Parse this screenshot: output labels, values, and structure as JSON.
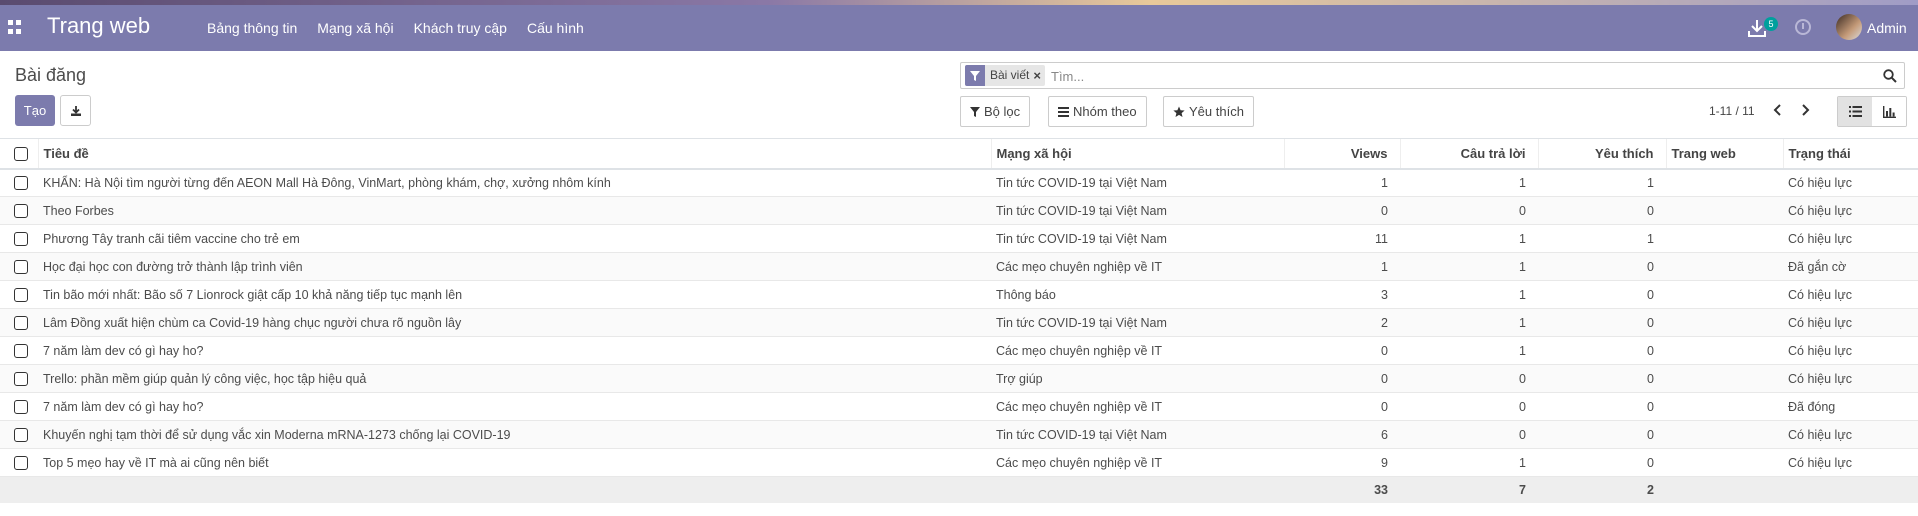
{
  "navbar": {
    "brand": "Trang web",
    "menu": [
      "Bảng thông tin",
      "Mạng xã hội",
      "Khách truy cập",
      "Cấu hình"
    ],
    "download_badge": "5",
    "user": "Admin"
  },
  "control": {
    "title": "Bài đăng",
    "create_label": "Tạo",
    "facet_label": "Bài viết",
    "facet_remove": "×",
    "search_placeholder": "Tìm...",
    "filters_label": "Bộ lọc",
    "group_label": "Nhóm theo",
    "favorites_label": "Yêu thích",
    "pager": "1-11 / 11"
  },
  "table": {
    "headers": {
      "title": "Tiêu đề",
      "network": "Mạng xã hội",
      "views": "Views",
      "replies": "Câu trả lời",
      "likes": "Yêu thích",
      "website": "Trang web",
      "status": "Trạng thái"
    },
    "rows": [
      {
        "title": "KHẨN: Hà Nội tìm người từng đến AEON Mall Hà Đông, VinMart, phòng khám, chợ, xưởng nhôm kính",
        "network": "Tin tức COVID-19 tại Việt Nam",
        "views": "1",
        "replies": "1",
        "likes": "1",
        "website": "",
        "status": "Có hiệu lực"
      },
      {
        "title": "Theo Forbes",
        "network": "Tin tức COVID-19 tại Việt Nam",
        "views": "0",
        "replies": "0",
        "likes": "0",
        "website": "",
        "status": "Có hiệu lực"
      },
      {
        "title": "Phương Tây tranh cãi tiêm vaccine cho trẻ em",
        "network": "Tin tức COVID-19 tại Việt Nam",
        "views": "11",
        "replies": "1",
        "likes": "1",
        "website": "",
        "status": "Có hiệu lực"
      },
      {
        "title": "Học đại học con đường trở thành lập trình viên",
        "network": "Các mẹo chuyên nghiệp về IT",
        "views": "1",
        "replies": "1",
        "likes": "0",
        "website": "",
        "status": "Đã gắn cờ"
      },
      {
        "title": "Tin bão mới nhất: Bão số 7 Lionrock giật cấp 10 khả năng tiếp tục mạnh lên",
        "network": "Thông báo",
        "views": "3",
        "replies": "1",
        "likes": "0",
        "website": "",
        "status": "Có hiệu lực"
      },
      {
        "title": "Lâm Đồng xuất hiện chùm ca Covid-19 hàng chục người chưa rõ nguồn lây",
        "network": "Tin tức COVID-19 tại Việt Nam",
        "views": "2",
        "replies": "1",
        "likes": "0",
        "website": "",
        "status": "Có hiệu lực"
      },
      {
        "title": "7 năm làm dev có gì hay ho?",
        "network": "Các mẹo chuyên nghiệp về IT",
        "views": "0",
        "replies": "1",
        "likes": "0",
        "website": "",
        "status": "Có hiệu lực"
      },
      {
        "title": "Trello: phần mềm giúp quản lý công việc, học tập hiệu quả",
        "network": "Trợ giúp",
        "views": "0",
        "replies": "0",
        "likes": "0",
        "website": "",
        "status": "Có hiệu lực"
      },
      {
        "title": "7 năm làm dev có gì hay ho?",
        "network": "Các mẹo chuyên nghiệp về IT",
        "views": "0",
        "replies": "0",
        "likes": "0",
        "website": "",
        "status": "Đã đóng"
      },
      {
        "title": "Khuyến nghị tạm thời để sử dụng vắc xin Moderna mRNA-1273 chống lại COVID-19",
        "network": "Tin tức COVID-19 tại Việt Nam",
        "views": "6",
        "replies": "0",
        "likes": "0",
        "website": "",
        "status": "Có hiệu lực"
      },
      {
        "title": "Top 5 mẹo hay về IT mà ai cũng nên biết",
        "network": "Các mẹo chuyên nghiệp về IT",
        "views": "9",
        "replies": "1",
        "likes": "0",
        "website": "",
        "status": "Có hiệu lực"
      }
    ],
    "totals": {
      "views": "33",
      "replies": "7",
      "likes": "2"
    }
  }
}
